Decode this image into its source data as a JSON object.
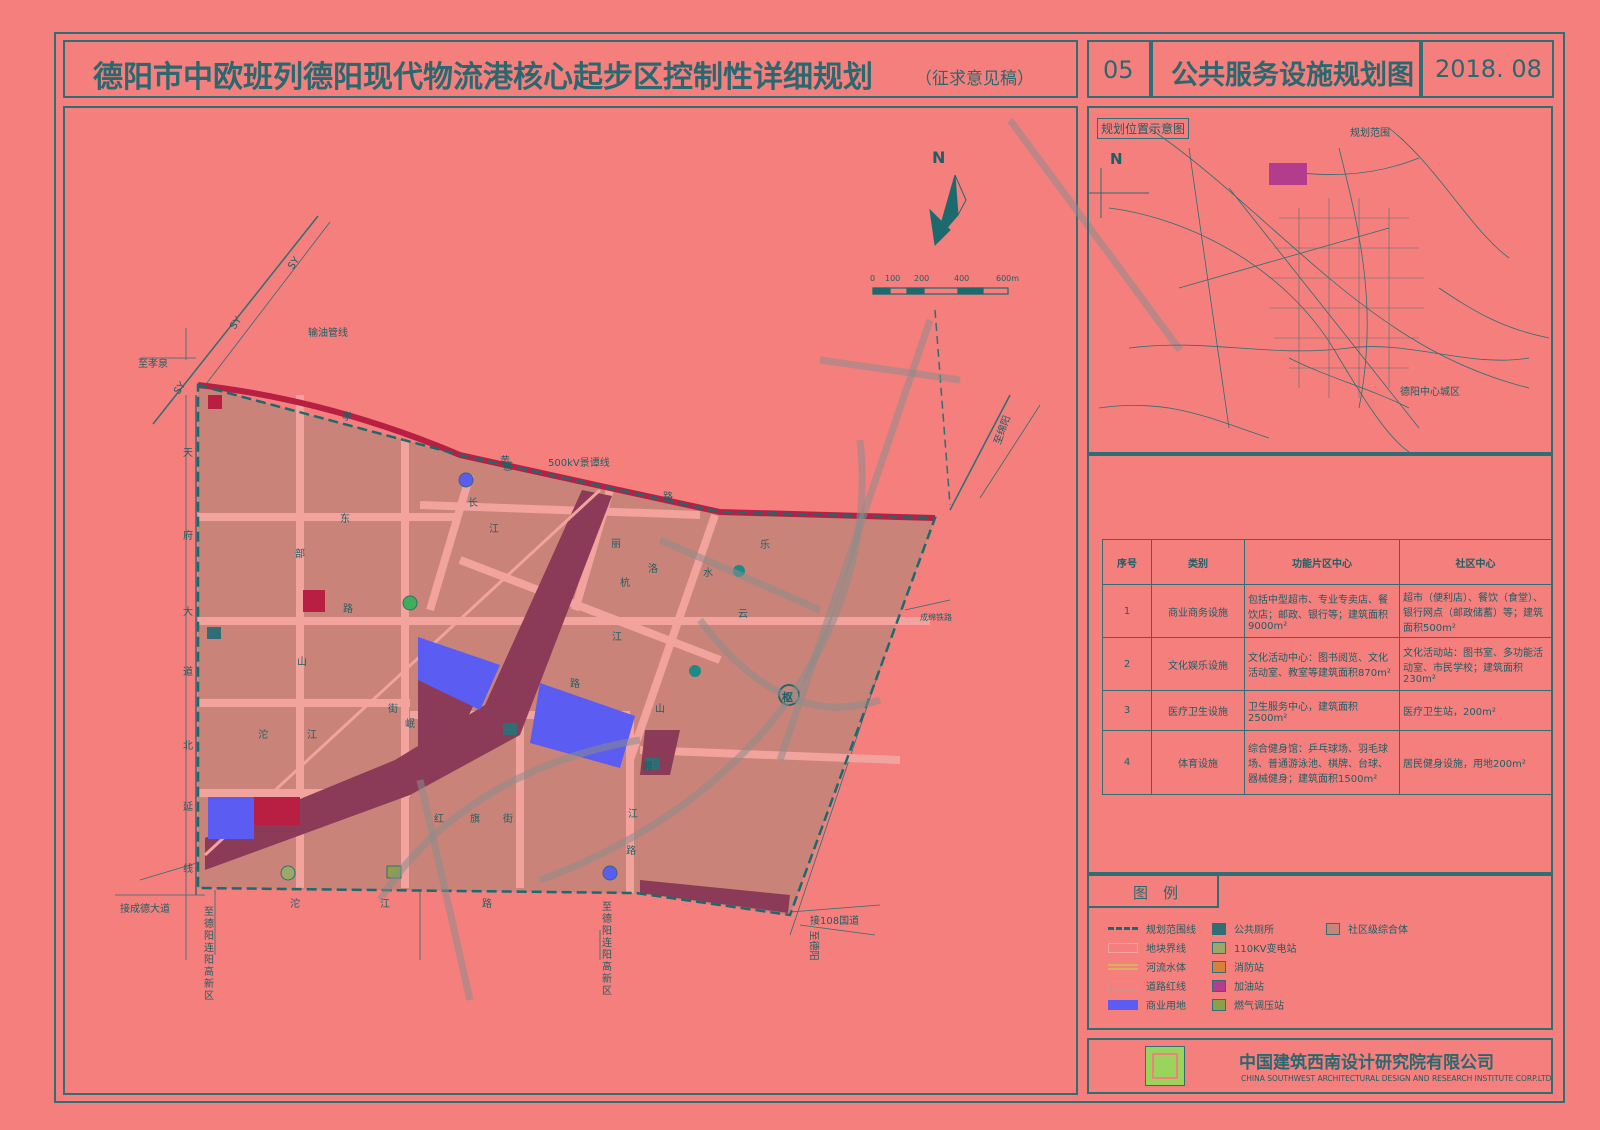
{
  "header": {
    "title": "德阳市中欧班列德阳现代物流港核心起步区控制性详细规划",
    "subtitle": "（征求意见稿）",
    "sheet_no": "05",
    "sheet_name": "公共服务设施规划图",
    "date": "2018. 08"
  },
  "map": {
    "north": "N",
    "scale_labels": [
      "0",
      "100",
      "200",
      "400",
      "600m"
    ],
    "labels": {
      "sy1": "SY",
      "sy2": "SY",
      "sy3": "SY",
      "pipeline": "输油管线",
      "to_xiaoquan": "至孝泉",
      "line_500kv": "500kV景谭线",
      "to_mianyang": "至绵阳",
      "to_deyang": "至德阳",
      "to_chengdu_rail": "接成德大道",
      "to_108": "接108国道",
      "to_newdist1": "至德阳连阳高新区",
      "to_newdist2": "至德阳连阳高新区",
      "railway": "成绵铁路",
      "wwm": "500",
      "hub": "枢"
    },
    "road_chars": [
      "天",
      "府",
      "大",
      "道",
      "北",
      "延",
      "线",
      "孝",
      "感",
      "东",
      "部",
      "长",
      "江",
      "路",
      "黄",
      "路",
      "沱",
      "江",
      "山",
      "街",
      "岷",
      "山",
      "红",
      "旗",
      "街",
      "沱",
      "江",
      "路",
      "湘",
      "江",
      "路",
      "丽",
      "杭",
      "江",
      "路",
      "洛",
      "水",
      "云",
      "乐"
    ]
  },
  "location_map": {
    "title": "规划位置示意图",
    "north": "N",
    "plan_range": "规划范围",
    "city": "德阳中心城区"
  },
  "table": {
    "headers": [
      "序号",
      "类别",
      "功能片区中心",
      "社区中心"
    ],
    "rows": [
      [
        "1",
        "商业商务设施",
        "包括中型超市、专业专卖店、餐饮店；邮政、银行等；建筑面积9000m²",
        "超市（便利店）、餐饮（食堂）、银行网点（邮政储蓄）等；建筑面积500m²"
      ],
      [
        "2",
        "文化娱乐设施",
        "文化活动中心：图书阅览、文化活动室、教室等建筑面积870m²",
        "文化活动站：图书室、多功能活动室、市民学校；建筑面积230m²"
      ],
      [
        "3",
        "医疗卫生设施",
        "卫生服务中心，建筑面积2500m²",
        "医疗卫生站，200m²"
      ],
      [
        "4",
        "体育设施",
        "综合健身馆：乒乓球场、羽毛球场、普通游泳池、棋牌、台球、器械健身；建筑面积1500m²",
        "居民健身设施，用地200m²"
      ]
    ]
  },
  "legend": {
    "title": "图　例",
    "items": [
      {
        "label": "规划范围线",
        "icon": "dashed-line"
      },
      {
        "label": "地块界线",
        "icon": "thin-line"
      },
      {
        "label": "河流水体",
        "icon": "river"
      },
      {
        "label": "道路红线",
        "icon": "road"
      },
      {
        "label": "商业用地",
        "icon": "blue-fill"
      },
      {
        "label": "公共厕所",
        "icon": "toilet-icon"
      },
      {
        "label": "110KV变电站",
        "icon": "substation-icon"
      },
      {
        "label": "消防站",
        "icon": "fire-station-icon"
      },
      {
        "label": "加油站",
        "icon": "gas-station-icon"
      },
      {
        "label": "燃气调压站",
        "icon": "gas-regulator-icon"
      },
      {
        "label": "社区级综合体",
        "icon": "community-icon"
      }
    ],
    "colors": {
      "commercial": "#5a5cf2",
      "plot": "#c98378",
      "dark": "#8b3a57",
      "red": "#b81f43",
      "line": "#2e6e74"
    }
  },
  "company": {
    "name_cn": "中国建筑西南设计研究院有限公司",
    "name_en": "CHINA SOUTHWEST ARCHITECTURAL DESIGN AND RESEARCH INSTITUTE CORP.LTD"
  }
}
